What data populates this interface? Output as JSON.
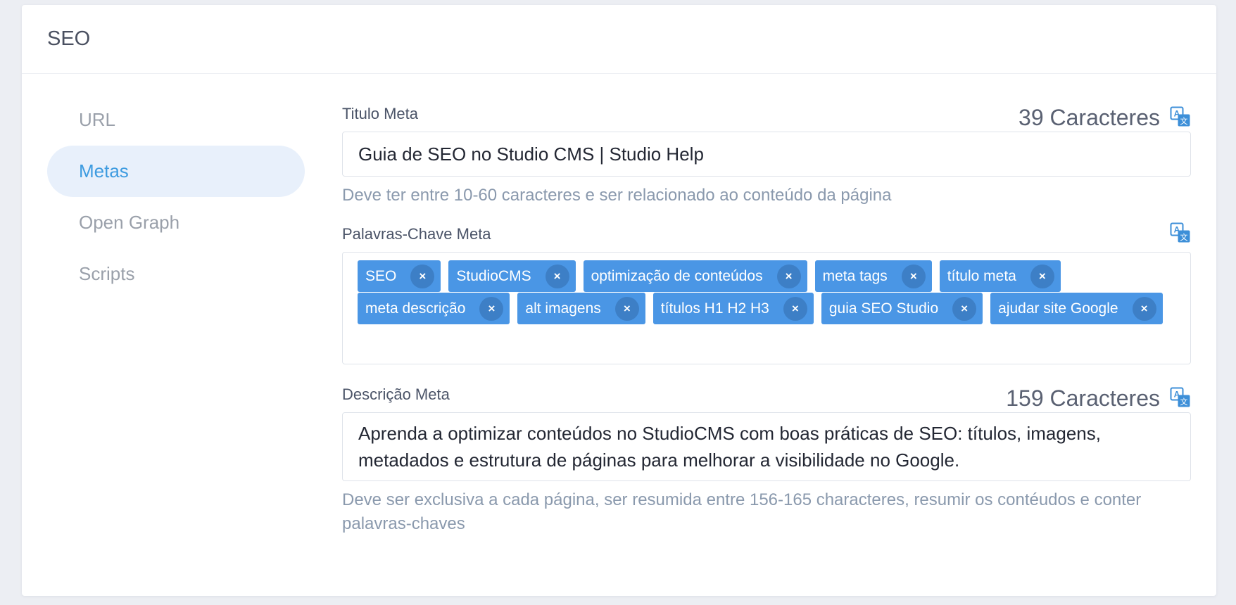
{
  "panel": {
    "title": "SEO"
  },
  "sidebar": {
    "items": [
      {
        "label": "URL",
        "active": false
      },
      {
        "label": "Metas",
        "active": true
      },
      {
        "label": "Open Graph",
        "active": false
      },
      {
        "label": "Scripts",
        "active": false
      }
    ]
  },
  "meta_title": {
    "label": "Titulo Meta",
    "char_count": "39 Caracteres",
    "value": "Guia de SEO no Studio CMS | Studio Help",
    "hint": "Deve ter entre 10-60 caracteres e ser relacionado ao conteúdo da página",
    "icon": "translate-icon"
  },
  "meta_keywords": {
    "label": "Palavras-Chave Meta",
    "icon": "translate-icon",
    "remove_glyph": "×",
    "tags": [
      "SEO",
      "StudioCMS",
      "optimização de conteúdos",
      "meta tags",
      "título meta",
      "meta descrição",
      "alt imagens",
      "títulos H1 H2 H3",
      "guia SEO Studio",
      "ajudar site Google"
    ]
  },
  "meta_description": {
    "label": "Descrição Meta",
    "char_count": "159 Caracteres",
    "value": "Aprenda a optimizar conteúdos no StudioCMS com boas práticas de SEO: títulos, imagens, metadados e estrutura de páginas para melhorar a visibilidade no Google.",
    "hint": "Deve ser exclusiva a cada página, ser resumida entre 156-165 characteres, resumir os contéudos e conter palavras-chaves",
    "icon": "translate-icon"
  },
  "colors": {
    "accent": "#3d9be0",
    "tag_bg": "#4a96e5",
    "tag_remove_bg": "#3d7fc6",
    "hint_text": "#8a99ad",
    "active_nav_bg": "#e8f0fb"
  }
}
